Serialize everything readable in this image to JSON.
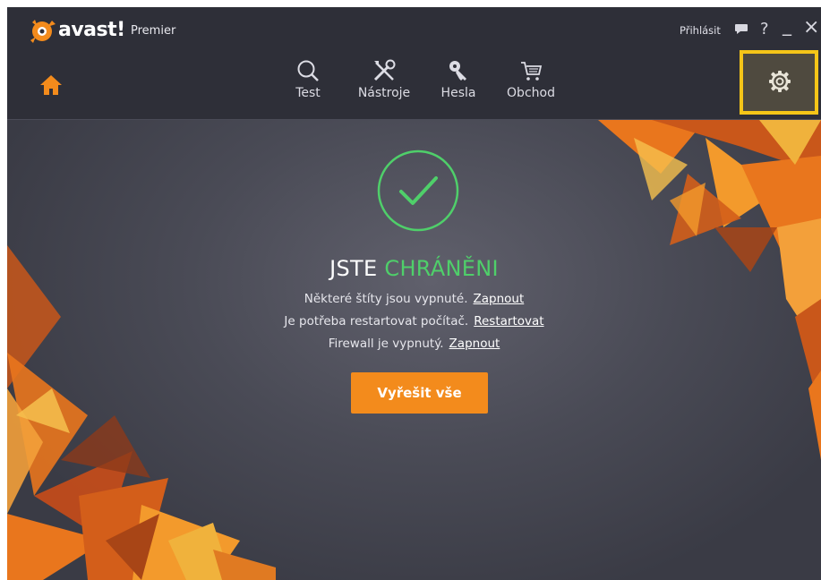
{
  "app": {
    "logo_text": "avast!",
    "edition": "Premier"
  },
  "window_controls": {
    "login": "Přihlásit",
    "help": "?",
    "minimize": "_",
    "close": "×"
  },
  "nav": {
    "items": [
      {
        "label": "Test",
        "icon": "search-icon"
      },
      {
        "label": "Nástroje",
        "icon": "tools-icon"
      },
      {
        "label": "Hesla",
        "icon": "key-icon"
      },
      {
        "label": "Obchod",
        "icon": "cart-icon"
      }
    ]
  },
  "status": {
    "headline_prefix": "JSTE ",
    "headline_status": "CHRÁNĚNI",
    "messages": [
      {
        "text": "Některé štíty jsou vypnuté.",
        "action": "Zapnout"
      },
      {
        "text": "Je potřeba restartovat počítač.",
        "action": "Restartovat"
      },
      {
        "text": "Firewall je vypnutý.",
        "action": "Zapnout"
      }
    ],
    "fix_all_button": "Vyřešit vše"
  },
  "colors": {
    "accent_orange": "#f38b1c",
    "status_green": "#4fcf6a",
    "highlight_yellow": "#f5c518",
    "background": "#3a3b45"
  }
}
